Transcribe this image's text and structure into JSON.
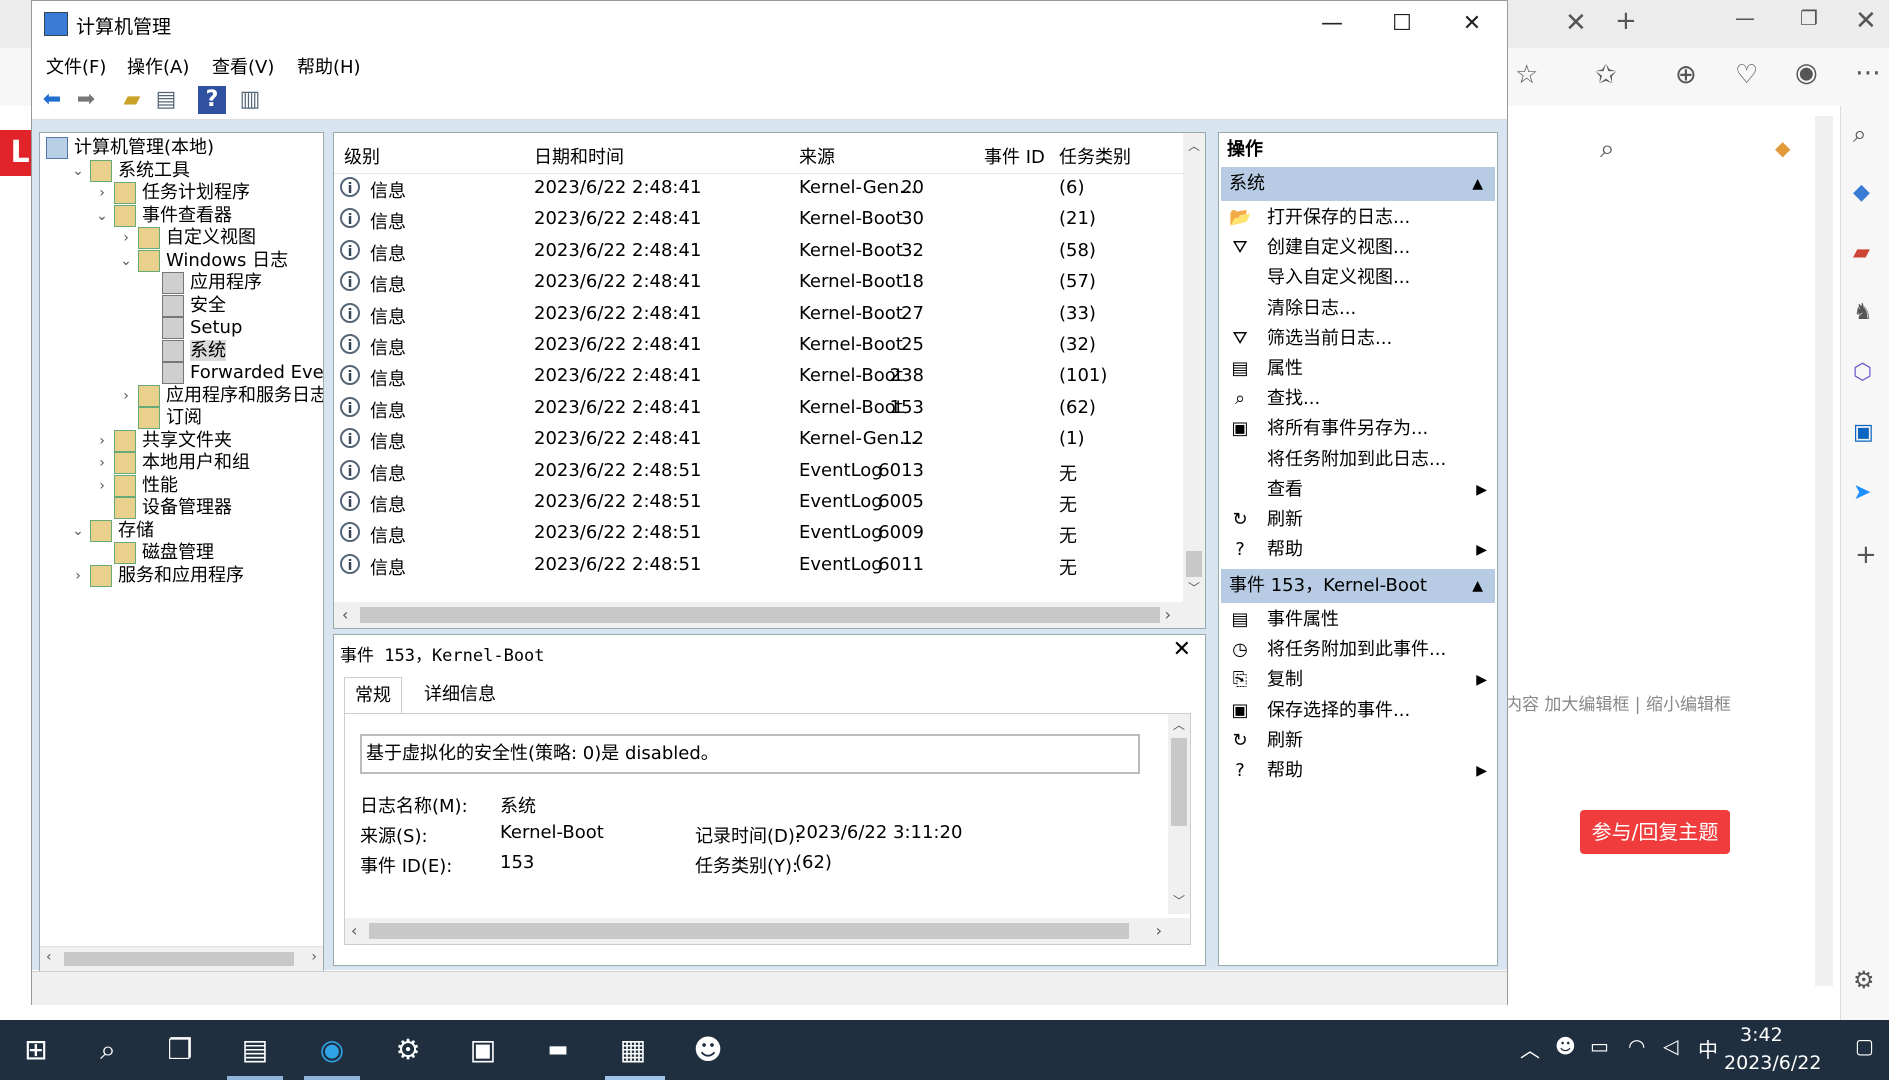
{
  "window": {
    "title": "计算机管理",
    "minimize": "—",
    "maximize": "☐",
    "close": "✕"
  },
  "menubar": [
    "文件(F)",
    "操作(A)",
    "查看(V)",
    "帮助(H)"
  ],
  "tree": [
    {
      "label": "计算机管理(本地)",
      "level": 0,
      "exp": ""
    },
    {
      "label": "系统工具",
      "level": 1,
      "exp": "⌄"
    },
    {
      "label": "任务计划程序",
      "level": 2,
      "exp": "›"
    },
    {
      "label": "事件查看器",
      "level": 2,
      "exp": "⌄"
    },
    {
      "label": "自定义视图",
      "level": 3,
      "exp": "›"
    },
    {
      "label": "Windows 日志",
      "level": 3,
      "exp": "⌄"
    },
    {
      "label": "应用程序",
      "level": 4,
      "exp": ""
    },
    {
      "label": "安全",
      "level": 4,
      "exp": ""
    },
    {
      "label": "Setup",
      "level": 4,
      "exp": ""
    },
    {
      "label": "系统",
      "level": 4,
      "exp": "",
      "selected": true
    },
    {
      "label": "Forwarded Even",
      "level": 4,
      "exp": ""
    },
    {
      "label": "应用程序和服务日志",
      "level": 3,
      "exp": "›"
    },
    {
      "label": "订阅",
      "level": 3,
      "exp": ""
    },
    {
      "label": "共享文件夹",
      "level": 2,
      "exp": "›"
    },
    {
      "label": "本地用户和组",
      "level": 2,
      "exp": "›"
    },
    {
      "label": "性能",
      "level": 2,
      "exp": "›"
    },
    {
      "label": "设备管理器",
      "level": 2,
      "exp": ""
    },
    {
      "label": "存储",
      "level": 1,
      "exp": "⌄"
    },
    {
      "label": "磁盘管理",
      "level": 2,
      "exp": ""
    },
    {
      "label": "服务和应用程序",
      "level": 1,
      "exp": "›"
    }
  ],
  "events": {
    "headers": [
      "级别",
      "日期和时间",
      "来源",
      "事件 ID",
      "任务类别"
    ],
    "rows": [
      [
        "信息",
        "2023/6/22 2:48:41",
        "Kernel-Gen...",
        "20",
        "(6)"
      ],
      [
        "信息",
        "2023/6/22 2:48:41",
        "Kernel-Boot",
        "30",
        "(21)"
      ],
      [
        "信息",
        "2023/6/22 2:48:41",
        "Kernel-Boot",
        "32",
        "(58)"
      ],
      [
        "信息",
        "2023/6/22 2:48:41",
        "Kernel-Boot",
        "18",
        "(57)"
      ],
      [
        "信息",
        "2023/6/22 2:48:41",
        "Kernel-Boot",
        "27",
        "(33)"
      ],
      [
        "信息",
        "2023/6/22 2:48:41",
        "Kernel-Boot",
        "25",
        "(32)"
      ],
      [
        "信息",
        "2023/6/22 2:48:41",
        "Kernel-Boot",
        "238",
        "(101)"
      ],
      [
        "信息",
        "2023/6/22 2:48:41",
        "Kernel-Boot",
        "153",
        "(62)"
      ],
      [
        "信息",
        "2023/6/22 2:48:41",
        "Kernel-Gen...",
        "12",
        "(1)"
      ],
      [
        "信息",
        "2023/6/22 2:48:51",
        "EventLog",
        "6013",
        "无"
      ],
      [
        "信息",
        "2023/6/22 2:48:51",
        "EventLog",
        "6005",
        "无"
      ],
      [
        "信息",
        "2023/6/22 2:48:51",
        "EventLog",
        "6009",
        "无"
      ],
      [
        "信息",
        "2023/6/22 2:48:51",
        "EventLog",
        "6011",
        "无"
      ]
    ]
  },
  "detail": {
    "title": "事件 153，Kernel-Boot",
    "tab_general": "常规",
    "tab_details": "详细信息",
    "description": "基于虚拟化的安全性(策略: 0)是 disabled。",
    "log_name_label": "日志名称(M):",
    "log_name": "系统",
    "source_label": "来源(S):",
    "source": "Kernel-Boot",
    "logged_label": "记录时间(D):",
    "logged": "2023/6/22 3:11:20",
    "event_id_label": "事件 ID(E):",
    "event_id": "153",
    "task_label": "任务类别(Y):",
    "task": "(62)"
  },
  "actions": {
    "header": "操作",
    "section1": "系统",
    "items1": [
      {
        "label": "打开保存的日志...",
        "icon": "📂"
      },
      {
        "label": "创建自定义视图...",
        "icon": "⛛"
      },
      {
        "label": "导入自定义视图...",
        "icon": ""
      },
      {
        "label": "清除日志...",
        "icon": ""
      },
      {
        "label": "筛选当前日志...",
        "icon": "⛛"
      },
      {
        "label": "属性",
        "icon": "▤"
      },
      {
        "label": "查找...",
        "icon": "⌕"
      },
      {
        "label": "将所有事件另存为...",
        "icon": "▣"
      },
      {
        "label": "将任务附加到此日志...",
        "icon": ""
      },
      {
        "label": "查看",
        "icon": "",
        "arrow": true
      },
      {
        "label": "刷新",
        "icon": "↻"
      },
      {
        "label": "帮助",
        "icon": "?",
        "arrow": true
      }
    ],
    "section2": "事件 153，Kernel-Boot",
    "items2": [
      {
        "label": "事件属性",
        "icon": "▤"
      },
      {
        "label": "将任务附加到此事件...",
        "icon": "◷"
      },
      {
        "label": "复制",
        "icon": "⎘",
        "arrow": true
      },
      {
        "label": "保存选择的事件...",
        "icon": "▣"
      },
      {
        "label": "刷新",
        "icon": "↻"
      },
      {
        "label": "帮助",
        "icon": "?",
        "arrow": true
      }
    ]
  },
  "background": {
    "reply_button": "参与/回复主题",
    "editor_links": "内容    加大编辑框 | 缩小编辑框",
    "logo_letter": "L"
  },
  "taskbar": {
    "time": "3:42",
    "date": "2023/6/22",
    "ime": "中"
  },
  "colors": {
    "selection": "#b7cce4",
    "accent": "#3a7bd5",
    "reply_red": "#f03c3c"
  }
}
